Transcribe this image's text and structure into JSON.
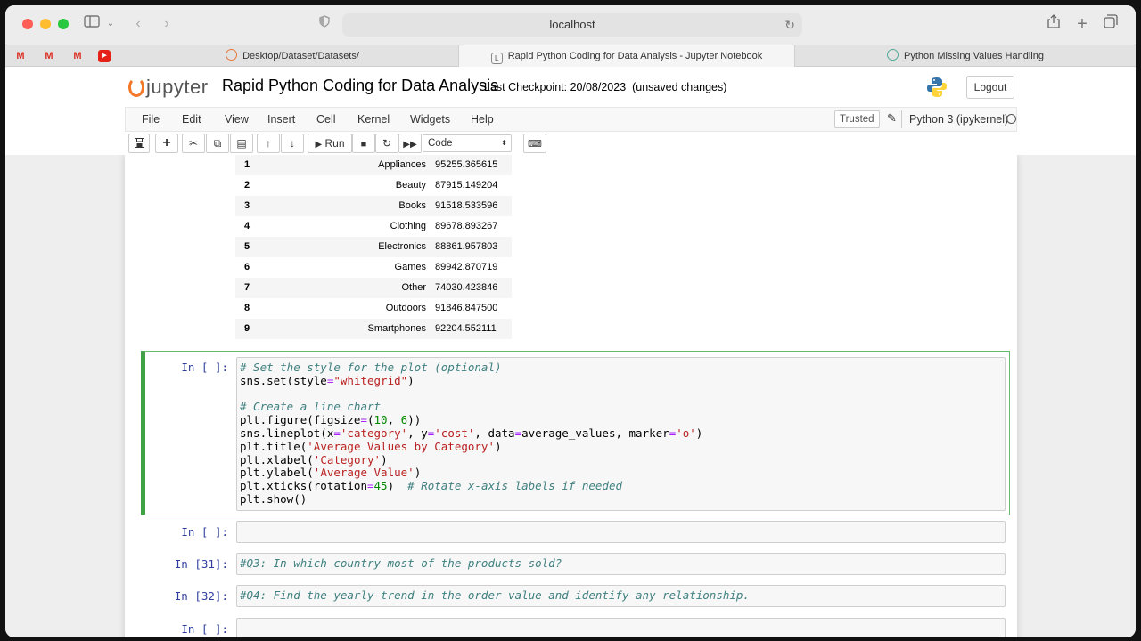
{
  "browser": {
    "address": "localhost",
    "tabs": [
      {
        "label": "Desktop/Dataset/Datasets/"
      },
      {
        "label": "Rapid Python Coding for Data Analysis - Jupyter Notebook"
      },
      {
        "label": "Python Missing Values Handling"
      }
    ]
  },
  "jupyter": {
    "logo_text": "jupyter",
    "notebook_title": "Rapid Python Coding for Data Analysis",
    "checkpoint": "Last Checkpoint: 20/08/2023",
    "unsaved": "(unsaved changes)",
    "logout": "Logout",
    "menu": [
      "File",
      "Edit",
      "View",
      "Insert",
      "Cell",
      "Kernel",
      "Widgets",
      "Help"
    ],
    "trusted": "Trusted",
    "kernel_name": "Python 3 (ipykernel)",
    "run_label": "Run",
    "cell_type": "Code"
  },
  "dataframe_rows": [
    {
      "index": "1",
      "category": "Appliances",
      "value": "95255.365615"
    },
    {
      "index": "2",
      "category": "Beauty",
      "value": "87915.149204"
    },
    {
      "index": "3",
      "category": "Books",
      "value": "91518.533596"
    },
    {
      "index": "4",
      "category": "Clothing",
      "value": "89678.893267"
    },
    {
      "index": "5",
      "category": "Electronics",
      "value": "88861.957803"
    },
    {
      "index": "6",
      "category": "Games",
      "value": "89942.870719"
    },
    {
      "index": "7",
      "category": "Other",
      "value": "74030.423846"
    },
    {
      "index": "8",
      "category": "Outdoors",
      "value": "91846.847500"
    },
    {
      "index": "9",
      "category": "Smartphones",
      "value": "92204.552111"
    }
  ],
  "cells": {
    "c1_prompt": "In [ ]:",
    "c2_prompt": "In [ ]:",
    "c3_prompt": "In [31]:",
    "c3_code": "#Q3: In which country most of the products sold?",
    "c4_prompt": "In [32]:",
    "c4_code": "#Q4: Find the yearly trend in the order value and identify any relationship.",
    "c5_prompt": "In [ ]:"
  }
}
